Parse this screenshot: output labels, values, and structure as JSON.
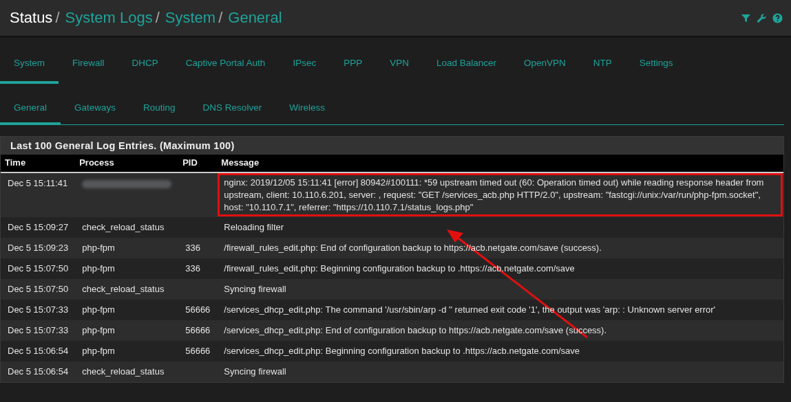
{
  "breadcrumb": [
    {
      "label": "Status",
      "kind": "current",
      "separator": "/"
    },
    {
      "label": "System Logs",
      "kind": "link",
      "separator": "/"
    },
    {
      "label": "System",
      "kind": "link",
      "separator": "/"
    },
    {
      "label": "General",
      "kind": "link"
    }
  ],
  "tabs": [
    {
      "label": "System",
      "selected": true
    },
    {
      "label": "Firewall",
      "selected": false
    },
    {
      "label": "DHCP",
      "selected": false
    },
    {
      "label": "Captive Portal Auth",
      "selected": false
    },
    {
      "label": "IPsec",
      "selected": false
    },
    {
      "label": "PPP",
      "selected": false
    },
    {
      "label": "VPN",
      "selected": false
    },
    {
      "label": "Load Balancer",
      "selected": false
    },
    {
      "label": "OpenVPN",
      "selected": false
    },
    {
      "label": "NTP",
      "selected": false
    },
    {
      "label": "Settings",
      "selected": false
    }
  ],
  "subtabs": [
    {
      "label": "General",
      "selected": true
    },
    {
      "label": "Gateways",
      "selected": false
    },
    {
      "label": "Routing",
      "selected": false
    },
    {
      "label": "DNS Resolver",
      "selected": false
    },
    {
      "label": "Wireless",
      "selected": false
    }
  ],
  "panel": {
    "title": "Last 100 General Log Entries. (Maximum 100)",
    "columns": [
      "Time",
      "Process",
      "PID",
      "Message"
    ],
    "rows": [
      {
        "time": "Dec 5 15:11:41",
        "process_redacted": true,
        "pid": "",
        "message": "nginx: 2019/12/05 15:11:41 [error] 80942#100111: *59 upstream timed out (60: Operation timed out) while reading response header from upstream, client: 10.110.6.201, server: , request: \"GET /services_acb.php HTTP/2.0\", upstream: \"fastcgi://unix:/var/run/php-fpm.socket\", host: \"10.110.7.1\", referrer: \"https://10.110.7.1/status_logs.php\"",
        "highlighted": true
      },
      {
        "time": "Dec 5 15:09:27",
        "process": "check_reload_status",
        "pid": "",
        "message": "Reloading filter",
        "highlighted": false
      },
      {
        "time": "Dec 5 15:09:23",
        "process": "php-fpm",
        "pid": "336",
        "message": "/firewall_rules_edit.php: End of configuration backup to https://acb.netgate.com/save (success).",
        "highlighted": false
      },
      {
        "time": "Dec 5 15:07:50",
        "process": "php-fpm",
        "pid": "336",
        "message": "/firewall_rules_edit.php: Beginning configuration backup to .https://acb.netgate.com/save",
        "highlighted": false
      },
      {
        "time": "Dec 5 15:07:50",
        "process": "check_reload_status",
        "pid": "",
        "message": "Syncing firewall",
        "highlighted": false
      },
      {
        "time": "Dec 5 15:07:33",
        "process": "php-fpm",
        "pid": "56666",
        "message": "/services_dhcp_edit.php: The command '/usr/sbin/arp -d '' returned exit code '1', the output was 'arp: : Unknown server error'",
        "highlighted": false
      },
      {
        "time": "Dec 5 15:07:33",
        "process": "php-fpm",
        "pid": "56666",
        "message": "/services_dhcp_edit.php: End of configuration backup to https://acb.netgate.com/save (success).",
        "highlighted": false
      },
      {
        "time": "Dec 5 15:06:54",
        "process": "php-fpm",
        "pid": "56666",
        "message": "/services_dhcp_edit.php: Beginning configuration backup to .https://acb.netgate.com/save",
        "highlighted": false
      },
      {
        "time": "Dec 5 15:06:54",
        "process": "check_reload_status",
        "pid": "",
        "message": "Syncing firewall",
        "highlighted": false
      }
    ]
  }
}
